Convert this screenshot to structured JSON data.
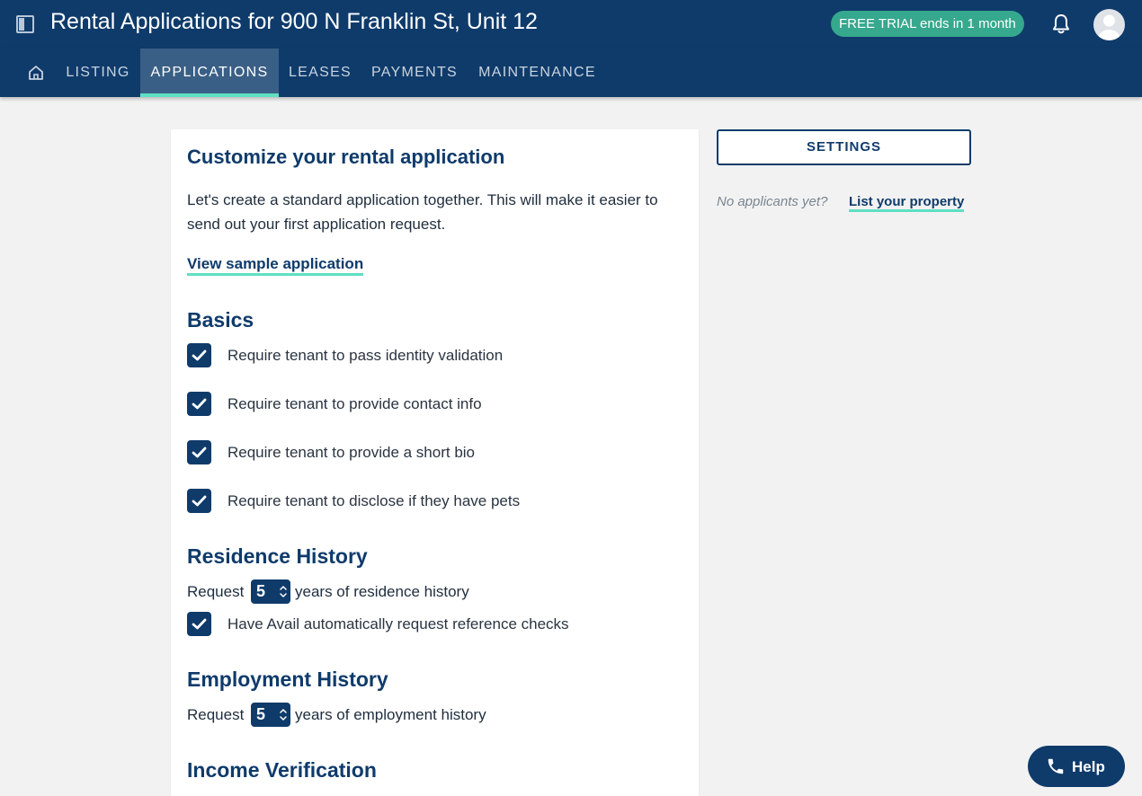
{
  "header": {
    "title": "Rental Applications for 900 N Franklin St, Unit 12",
    "trial_badge": "FREE TRIAL ends in 1 month"
  },
  "nav": {
    "tabs": [
      {
        "label": "LISTING",
        "active": false
      },
      {
        "label": "APPLICATIONS",
        "active": true
      },
      {
        "label": "LEASES",
        "active": false
      },
      {
        "label": "PAYMENTS",
        "active": false
      },
      {
        "label": "MAINTENANCE",
        "active": false
      }
    ]
  },
  "main": {
    "title": "Customize your rental application",
    "intro": "Let's create a standard application together. This will make it easier to send out your first application request.",
    "sample_link": "View sample application",
    "basics": {
      "heading": "Basics",
      "items": [
        {
          "label": "Require tenant to pass identity validation",
          "checked": true
        },
        {
          "label": "Require tenant to provide contact info",
          "checked": true
        },
        {
          "label": "Require tenant to provide a short bio",
          "checked": true
        },
        {
          "label": "Require tenant to disclose if they have pets",
          "checked": true
        }
      ]
    },
    "residence": {
      "heading": "Residence History",
      "prefix": "Request",
      "years": "5",
      "suffix": "years of residence history",
      "reference_check": {
        "label": "Have Avail automatically request reference checks",
        "checked": true
      }
    },
    "employment": {
      "heading": "Employment History",
      "prefix": "Request",
      "years": "5",
      "suffix": "years of employment history"
    },
    "income": {
      "heading": "Income Verification"
    }
  },
  "sidebar": {
    "settings_label": "SETTINGS",
    "no_applicants": "No applicants yet?",
    "list_link": "List your property"
  },
  "help": {
    "label": "Help"
  },
  "colors": {
    "navy": "#0f3b6b",
    "accent": "#5ee0c3",
    "badge": "#36a88d",
    "active_tab": "#3a5f86"
  }
}
